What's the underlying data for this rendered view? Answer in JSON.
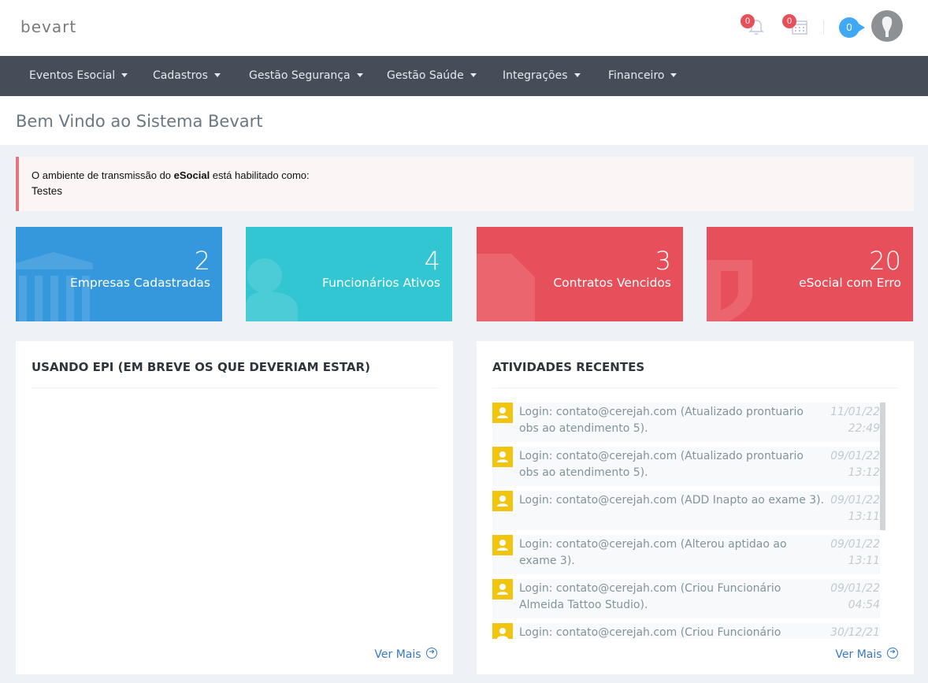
{
  "header": {
    "logo": "bevart",
    "notifications_count": "0",
    "tasks_count": "0",
    "messages_count": "0"
  },
  "nav": {
    "items": [
      {
        "label": "Eventos Esocial"
      },
      {
        "label": "Cadastros"
      },
      {
        "label": "Gestão Segurança"
      },
      {
        "label": "Gestão Saúde"
      },
      {
        "label": "Integrações"
      },
      {
        "label": "Financeiro"
      }
    ]
  },
  "page": {
    "title": "Bem Vindo ao Sistema Bevart"
  },
  "alert": {
    "prefix": "O ambiente de transmissão do ",
    "bold": "eSocial",
    "suffix": " está habilitado como:",
    "value": "Testes"
  },
  "stats": [
    {
      "value": "2",
      "label": "Empresas Cadastradas",
      "color": "#3598dc",
      "icon": "bank-icon"
    },
    {
      "value": "4",
      "label": "Funcionários Ativos",
      "color": "#32c5d2",
      "icon": "user-icon"
    },
    {
      "value": "3",
      "label": "Contratos Vencidos",
      "color": "#e7505a",
      "icon": "document-icon"
    },
    {
      "value": "20",
      "label": "eSocial com Erro",
      "color": "#e7505a",
      "icon": "shield-icon"
    }
  ],
  "epi_panel": {
    "title": "USANDO EPI (EM BREVE OS QUE DEVERIAM ESTAR)",
    "more_label": "Ver Mais"
  },
  "activity_panel": {
    "title": "ATIVIDADES RECENTES",
    "more_label": "Ver Mais",
    "items": [
      {
        "text": "Login: contato@cerejah.com (Atualizado prontuario obs ao atendimento 5).",
        "date": "11/01/22",
        "time": "22:49"
      },
      {
        "text": "Login: contato@cerejah.com (Atualizado prontuario obs ao atendimento 5).",
        "date": "09/01/22",
        "time": "13:12"
      },
      {
        "text": "Login: contato@cerejah.com (ADD Inapto ao exame 3).",
        "date": "09/01/22",
        "time": "13:11"
      },
      {
        "text": "Login: contato@cerejah.com (Alterou aptidao ao exame 3).",
        "date": "09/01/22",
        "time": "13:11"
      },
      {
        "text": "Login: contato@cerejah.com (Criou Funcionário Almeida Tattoo Studio).",
        "date": "09/01/22",
        "time": "04:54"
      },
      {
        "text": "Login: contato@cerejah.com (Criou Funcionário Mauricio",
        "date": "30/12/21",
        "time": ""
      }
    ]
  }
}
